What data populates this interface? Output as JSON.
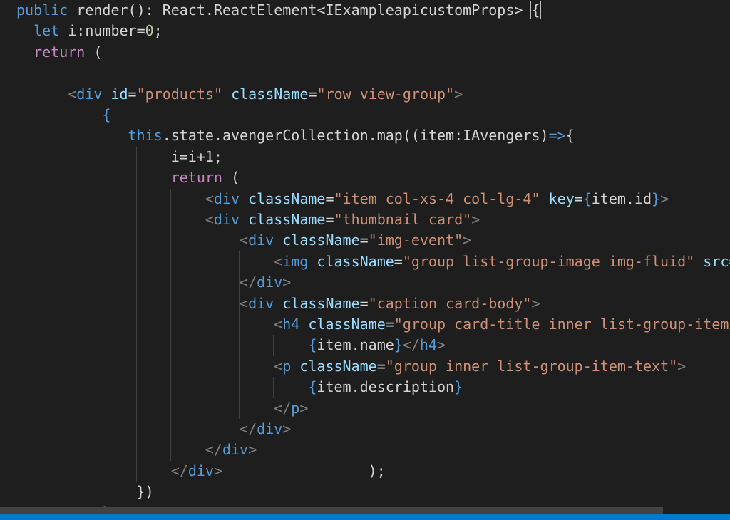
{
  "editor": {
    "language": "TypeScript React",
    "lines": [
      {
        "indent": 1,
        "tokens": [
          [
            "kw",
            "public"
          ],
          [
            "txt",
            " render(): React.ReactElement<IExampleapicustomProps> "
          ],
          [
            "cursor",
            "{"
          ]
        ]
      },
      {
        "indent": 2,
        "tokens": [
          [
            "kw",
            "let"
          ],
          [
            "txt",
            " i:number="
          ],
          [
            "num",
            "0"
          ],
          [
            "txt",
            ";"
          ]
        ]
      },
      {
        "indent": 2,
        "tokens": [
          [
            "ctl",
            "return"
          ],
          [
            "txt",
            " ("
          ]
        ]
      },
      {
        "indent": 0,
        "tokens": []
      },
      {
        "indent": 4,
        "tokens": [
          [
            "punc",
            "<"
          ],
          [
            "tag",
            "div"
          ],
          [
            "txt",
            " "
          ],
          [
            "attr",
            "id"
          ],
          [
            "txt",
            "="
          ],
          [
            "str",
            "\"products\""
          ],
          [
            "txt",
            " "
          ],
          [
            "attr",
            "className"
          ],
          [
            "txt",
            "="
          ],
          [
            "str",
            "\"row view-group\""
          ],
          [
            "punc",
            ">"
          ]
        ]
      },
      {
        "indent": 6,
        "tokens": [
          [
            "brace",
            "{"
          ]
        ]
      },
      {
        "indent": 7.5,
        "tokens": [
          [
            "kw",
            "this"
          ],
          [
            "txt",
            ".state.avengerCollection.map((item:IAvengers)"
          ],
          [
            "kw",
            "=>"
          ],
          [
            "txt",
            "{"
          ]
        ]
      },
      {
        "indent": 10,
        "tokens": [
          [
            "txt",
            "i=i+1;"
          ]
        ]
      },
      {
        "indent": 10,
        "tokens": [
          [
            "ctl",
            "return"
          ],
          [
            "txt",
            " ("
          ]
        ]
      },
      {
        "indent": 12,
        "tokens": [
          [
            "punc",
            "<"
          ],
          [
            "tag",
            "div"
          ],
          [
            "txt",
            " "
          ],
          [
            "attr",
            "className"
          ],
          [
            "txt",
            "="
          ],
          [
            "str",
            "\"item col-xs-4 col-lg-4\""
          ],
          [
            "txt",
            " "
          ],
          [
            "attr",
            "key"
          ],
          [
            "txt",
            "="
          ],
          [
            "brace",
            "{"
          ],
          [
            "txt",
            "item.id"
          ],
          [
            "brace",
            "}"
          ],
          [
            "punc",
            ">"
          ]
        ]
      },
      {
        "indent": 12,
        "tokens": [
          [
            "punc",
            "<"
          ],
          [
            "tag",
            "div"
          ],
          [
            "txt",
            " "
          ],
          [
            "attr",
            "className"
          ],
          [
            "txt",
            "="
          ],
          [
            "str",
            "\"thumbnail card\""
          ],
          [
            "punc",
            ">"
          ]
        ]
      },
      {
        "indent": 14,
        "tokens": [
          [
            "punc",
            "<"
          ],
          [
            "tag",
            "div"
          ],
          [
            "txt",
            " "
          ],
          [
            "attr",
            "className"
          ],
          [
            "txt",
            "="
          ],
          [
            "str",
            "\"img-event\""
          ],
          [
            "punc",
            ">"
          ]
        ]
      },
      {
        "indent": 16,
        "tokens": [
          [
            "punc",
            "<"
          ],
          [
            "tag",
            "img"
          ],
          [
            "txt",
            " "
          ],
          [
            "attr",
            "className"
          ],
          [
            "txt",
            "="
          ],
          [
            "str",
            "\"group list-group-image img-fluid\""
          ],
          [
            "txt",
            " "
          ],
          [
            "attr",
            "src"
          ],
          [
            "txt",
            "="
          ]
        ]
      },
      {
        "indent": 14,
        "tokens": [
          [
            "punc",
            "</"
          ],
          [
            "tag",
            "div"
          ],
          [
            "punc",
            ">"
          ]
        ]
      },
      {
        "indent": 14,
        "tokens": [
          [
            "punc",
            "<"
          ],
          [
            "tag",
            "div"
          ],
          [
            "txt",
            " "
          ],
          [
            "attr",
            "className"
          ],
          [
            "txt",
            "="
          ],
          [
            "str",
            "\"caption card-body\""
          ],
          [
            "punc",
            ">"
          ]
        ]
      },
      {
        "indent": 16,
        "tokens": [
          [
            "punc",
            "<"
          ],
          [
            "tag",
            "h4"
          ],
          [
            "txt",
            " "
          ],
          [
            "attr",
            "className"
          ],
          [
            "txt",
            "="
          ],
          [
            "str",
            "\"group card-title inner list-group-item-"
          ]
        ]
      },
      {
        "indent": 18,
        "tokens": [
          [
            "brace",
            "{"
          ],
          [
            "txt",
            "item.name"
          ],
          [
            "brace",
            "}"
          ],
          [
            "punc",
            "</"
          ],
          [
            "tag",
            "h4"
          ],
          [
            "punc",
            ">"
          ]
        ]
      },
      {
        "indent": 16,
        "tokens": [
          [
            "punc",
            "<"
          ],
          [
            "tag",
            "p"
          ],
          [
            "txt",
            " "
          ],
          [
            "attr",
            "className"
          ],
          [
            "txt",
            "="
          ],
          [
            "str",
            "\"group inner list-group-item-text\""
          ],
          [
            "punc",
            ">"
          ]
        ]
      },
      {
        "indent": 18,
        "tokens": [
          [
            "brace",
            "{"
          ],
          [
            "txt",
            "item.description"
          ],
          [
            "brace",
            "}"
          ]
        ]
      },
      {
        "indent": 16,
        "tokens": [
          [
            "punc",
            "</"
          ],
          [
            "tag",
            "p"
          ],
          [
            "punc",
            ">"
          ]
        ]
      },
      {
        "indent": 14,
        "tokens": [
          [
            "punc",
            "</"
          ],
          [
            "tag",
            "div"
          ],
          [
            "punc",
            ">"
          ]
        ]
      },
      {
        "indent": 12,
        "tokens": [
          [
            "punc",
            "</"
          ],
          [
            "tag",
            "div"
          ],
          [
            "punc",
            ">"
          ]
        ]
      },
      {
        "indent": 10,
        "tokens": [
          [
            "punc",
            "</"
          ],
          [
            "tag",
            "div"
          ],
          [
            "punc",
            ">"
          ],
          [
            "txt",
            "                 );"
          ]
        ]
      },
      {
        "indent": 8,
        "tokens": [
          [
            "txt",
            "})"
          ]
        ]
      },
      {
        "indent": 6,
        "tokens": [
          [
            "brace",
            "}"
          ]
        ]
      }
    ]
  }
}
